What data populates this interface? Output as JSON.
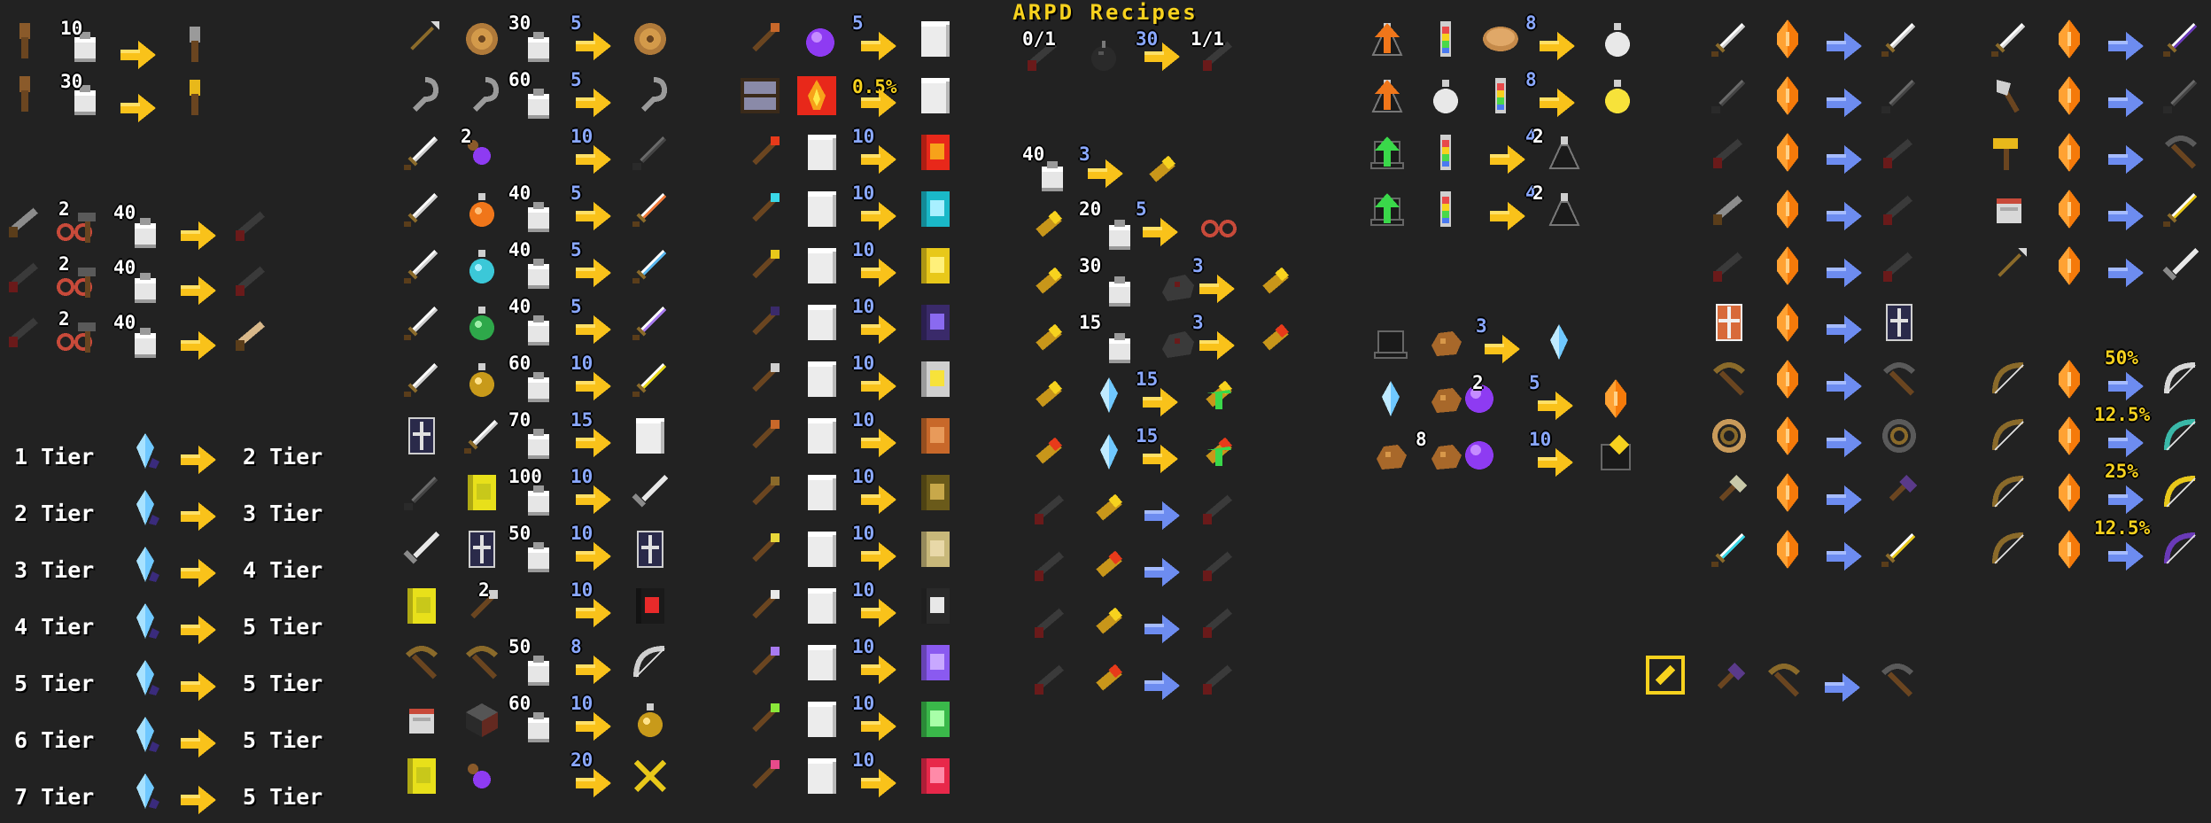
{
  "title": "ARPD Recipes",
  "colors": {
    "background": "#222222",
    "title": "#f7d21e",
    "yellow_arrow": "#f9c21a",
    "blue_arrow": "#6d8cf0",
    "count_blue": "#8aa8ff",
    "selection": "#f7d21e"
  },
  "tiers": {
    "input": [
      "1 Tier",
      "2 Tier",
      "3 Tier",
      "4 Tier",
      "5 Tier",
      "6 Tier",
      "7 Tier"
    ],
    "output": [
      "2 Tier",
      "3 Tier",
      "4 Tier",
      "5 Tier",
      "5 Tier",
      "5 Tier",
      "5 Tier"
    ]
  },
  "block1": {
    "weapon_upgrade_costs": [
      "10",
      "30"
    ],
    "gun_costs": [
      {
        "n": "2",
        "c": "40"
      },
      {
        "n": "2",
        "c": "40"
      },
      {
        "n": "2",
        "c": "40"
      }
    ]
  },
  "block2": {
    "costs": [
      "30",
      "60",
      "",
      "40",
      "40",
      "40",
      "60",
      "70",
      "100",
      "50",
      "",
      "50",
      "60",
      ""
    ],
    "counts": [
      "5",
      "5",
      "10",
      "5",
      "5",
      "5",
      "10",
      "15",
      "10",
      "10",
      "10",
      "8",
      "10",
      "20"
    ],
    "mult": [
      "",
      "",
      "2",
      "",
      "",
      "",
      "",
      "",
      "",
      "",
      "2",
      "",
      "",
      ""
    ]
  },
  "block3": {
    "counts": [
      "5",
      "",
      "10",
      "10",
      "10",
      "10",
      "10",
      "10",
      "10",
      "10",
      "10",
      "10",
      "10",
      "10"
    ],
    "percent": "0.5%"
  },
  "block4": {
    "top": {
      "a": "0/1",
      "b": "30",
      "c": "1/1"
    },
    "ammo_cost": {
      "cost": "40",
      "count": "3"
    },
    "rows": [
      {
        "cost": "20",
        "count": "5"
      },
      {
        "cost": "30",
        "count": "3"
      },
      {
        "cost": "15",
        "count": "3"
      },
      {
        "cost": "",
        "count": "15"
      },
      {
        "cost": "",
        "count": "15"
      }
    ]
  },
  "block5": {
    "counts": [
      "8",
      "8",
      "4",
      "4",
      "3",
      "5",
      "10"
    ],
    "mult": [
      "",
      "",
      "2",
      "2",
      "",
      "2",
      "8"
    ]
  },
  "block7": {
    "percents": [
      "50%",
      "12.5%",
      "25%",
      "12.5%"
    ]
  }
}
